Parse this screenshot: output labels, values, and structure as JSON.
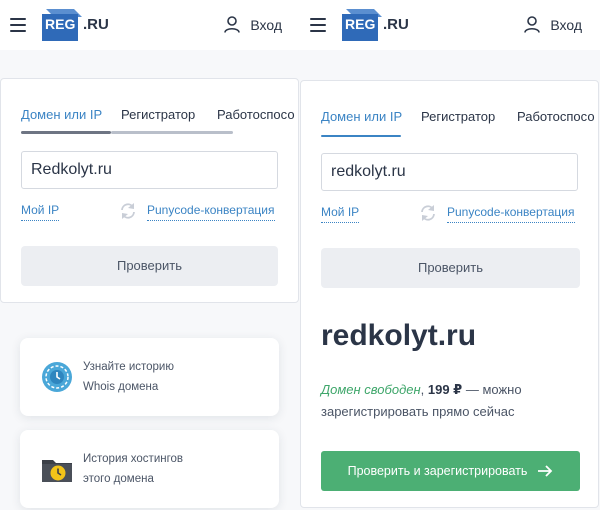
{
  "colors": {
    "accent": "#3b84c4",
    "brand": "#2f6ab8",
    "success_green": "#4caf74",
    "free_text": "#3ea66a",
    "text": "#2b3547",
    "button_gray": "#eceef2"
  },
  "header": {
    "menu_icon": "hamburger-menu-icon",
    "logo_mark": "REG",
    "logo_suffix": ".RU",
    "login_icon": "user-icon",
    "login_label": "Вход"
  },
  "left": {
    "tabs": [
      "Домен или IP",
      "Регистратор",
      "Работоспосо"
    ],
    "active_tab": 0,
    "input_value": "Redkolyt.ru",
    "my_ip_label": "Мой IP",
    "refresh_icon": "refresh-icon",
    "punycode_label": "Punycode-конвертация",
    "check_button": "Проверить",
    "promos": [
      {
        "icon": "whois-history-icon",
        "line1": "Узнайте историю",
        "line2": "Whois домена"
      },
      {
        "icon": "hosting-history-icon",
        "line1": "История хостингов",
        "line2": "этого домена"
      }
    ]
  },
  "right": {
    "tabs": [
      "Домен или IP",
      "Регистратор",
      "Работоспосо"
    ],
    "active_tab": 0,
    "input_value": "redkolyt.ru",
    "my_ip_label": "Мой IP",
    "refresh_icon": "refresh-icon",
    "punycode_label": "Punycode-конвертация",
    "check_button": "Проверить",
    "result": {
      "domain": "redkolyt.ru",
      "status_free": "Домен свободен",
      "separator": ", ",
      "price": "199 ₽",
      "status_rest": " — можно зарегистрировать прямо сейчас",
      "register_button": "Проверить и зарегистрировать",
      "arrow_icon": "arrow-right-icon"
    }
  }
}
